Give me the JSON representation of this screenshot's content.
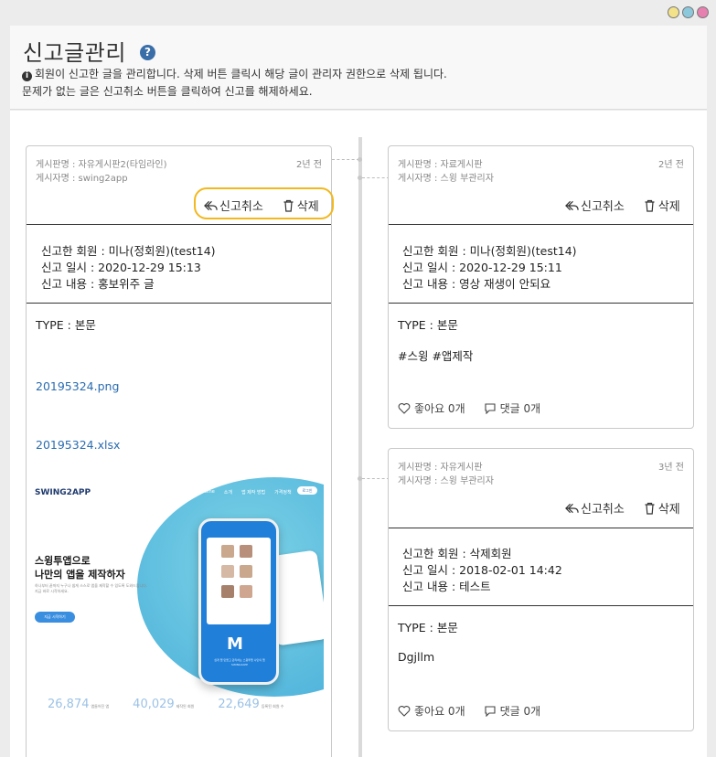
{
  "window": {
    "dot_colors": [
      "#f3e28a",
      "#8cc8dc",
      "#e680b0"
    ]
  },
  "header": {
    "title": "신고글관리",
    "help_icon": "?",
    "info_icon": "i",
    "desc_line1": "회원이 신고한 글을 관리합니다. 삭제 버튼 클릭시 해당 글이 관리자 권한으로 삭제 됩니다.",
    "desc_line2": "문제가 없는 글은 신고취소 버튼을 클릭하여 신고를 해제하세요."
  },
  "labels": {
    "cancel_report": "신고취소",
    "delete": "삭제"
  },
  "cards": [
    {
      "board": "게시판명 : 자유게시판2(타임라인)",
      "author": "게시자명 : swing2app",
      "time": "2년 전",
      "reporter": "신고한 회원 : 미나(정회원)(test14)",
      "report_date": "신고 일시 : 2020-12-29 15:13",
      "report_reason": "신고 내용 : 홍보위주 글",
      "type": "TYPE : 본문",
      "files": [
        "20195324.png",
        "20195324.xlsx"
      ]
    },
    {
      "board": "게시판명 : 자료게시판",
      "author": "게시자명 : 스윙 부관리자",
      "time": "2년 전",
      "reporter": "신고한 회원 : 미나(정회원)(test14)",
      "report_date": "신고 일시 : 2020-12-29 15:11",
      "report_reason": "신고 내용 : 영상 재생이 안되요",
      "type": "TYPE : 본문",
      "body": "#스윙 #앱제작",
      "likes": "좋아요 0개",
      "comments": "댓글 0개"
    },
    {
      "board": "게시판명 : 자유게시판",
      "author": "게시자명 : 스윙 부관리자",
      "time": "3년 전",
      "reporter": "신고한 회원 : 삭제회원",
      "report_date": "신고 일시 : 2018-02-01 14:42",
      "report_reason": "신고 내용 : 테스트",
      "type": "TYPE : 본문",
      "body": "Dgjllm",
      "likes": "좋아요 0개",
      "comments": "댓글 0개"
    }
  ],
  "preview": {
    "logo": "SWING2APP",
    "nav": [
      "Home",
      "소개",
      "앱 제작 방법",
      "가격정책"
    ],
    "nav_button": "로그인",
    "headline_1": "스윙투앱으로",
    "headline_2": "나만의 앱을 제작하자",
    "paragraph": "하나부터 끝까지 누구나 쉽게 스스로 앱을 제작할 수 있도록 도와드립니다. 지금 바로 시작하세요.",
    "cta": "지금 시작하기",
    "phone_logo": "M",
    "phone_text": "쉽게 앱 만들고 관리하는 스윙투앱 나만의 앱 SWING2APP",
    "stats": [
      {
        "value": "26,874",
        "label": "앱들어진 앱"
      },
      {
        "value": "40,029",
        "label": "제작된 회원"
      },
      {
        "value": "22,649",
        "label": "등록된 회원 수"
      }
    ]
  }
}
